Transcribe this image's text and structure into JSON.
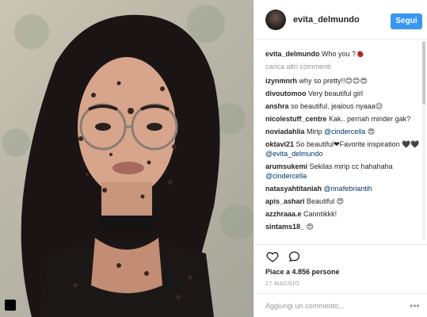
{
  "header": {
    "username": "evita_delmundo",
    "follow_label": "Segui"
  },
  "caption": {
    "username": "evita_delmundo",
    "text": "Who you ?🐞"
  },
  "load_more": "carica altri commenti",
  "comments": [
    {
      "user": "izynmnrh",
      "text": "why so pretty!!😊😊😍"
    },
    {
      "user": "divoutomoo",
      "text": "Very beautiful girl"
    },
    {
      "user": "anshra",
      "text": "so beautiful. jealous nyaaa😔"
    },
    {
      "user": "nicolestuff_centre",
      "text": "Kak.. pernah minder gak?"
    },
    {
      "user": "noviadahlia",
      "text": "Mirip",
      "mention": "@cindercella",
      "tail": "😍"
    },
    {
      "user": "oktavi21",
      "text": "So beautiful❤Favorite inspiration 🖤🖤",
      "mention": "@evita_delmundo"
    },
    {
      "user": "arumsukemi",
      "text": "Sekilas mirip cc hahahaha",
      "mention": "@cindercella"
    },
    {
      "user": "natasyahtitaniah",
      "mention": "@rinafebriantih"
    },
    {
      "user": "apis_ashari",
      "text": "Beautiful 😍"
    },
    {
      "user": "azzhraaa.e",
      "text": "Canntikkk!"
    },
    {
      "user": "sintams18_",
      "text": "😍"
    }
  ],
  "actions": {
    "like": "heart-icon",
    "comment": "comment-icon"
  },
  "likes_text": "Piace a 4.856 persone",
  "date": "27 MAGGIO",
  "add_comment_placeholder": "Aggiungi un commento...",
  "more_label": "•••",
  "colors": {
    "accent": "#3897f0",
    "mention": "#003569",
    "muted": "#999999"
  }
}
